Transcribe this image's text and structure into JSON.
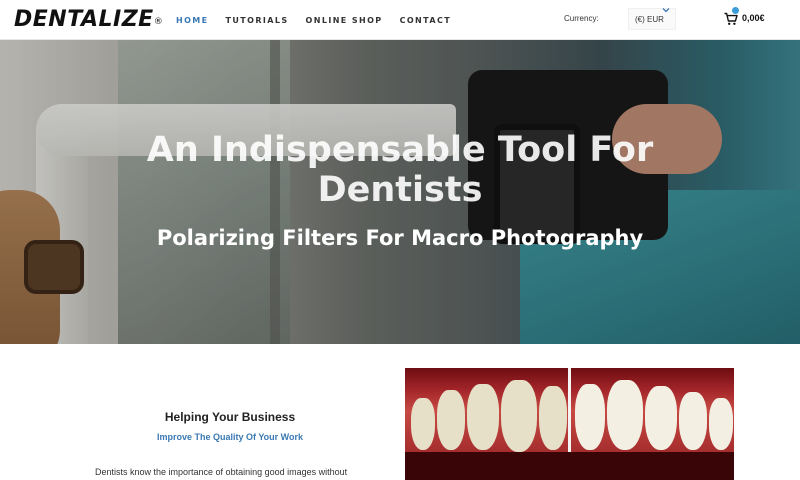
{
  "header": {
    "logo": "DENTALIZE",
    "logo_mark": "®",
    "nav": [
      {
        "label": "HOME",
        "active": true
      },
      {
        "label": "TUTORIALS",
        "active": false
      },
      {
        "label": "ONLINE SHOP",
        "active": false
      },
      {
        "label": "CONTACT",
        "active": false
      }
    ],
    "currency_label": "Currency:",
    "currency_value": "(€) EUR",
    "cart_total": "0,00€",
    "icons": {
      "currency": "chevron-down-icon",
      "cart": "shopping-cart-icon"
    }
  },
  "hero": {
    "title_line1": "An Indispensable Tool For",
    "title_line2": "Dentists",
    "subtitle": "Polarizing Filters For Macro Photography"
  },
  "section": {
    "title": "Helping Your Business",
    "subtitle": "Improve The Quality Of Your Work",
    "text": "Dentists know the importance of obtaining good images without"
  },
  "colors": {
    "accent": "#3a79b3",
    "text": "#222222",
    "background": "#ffffff"
  }
}
